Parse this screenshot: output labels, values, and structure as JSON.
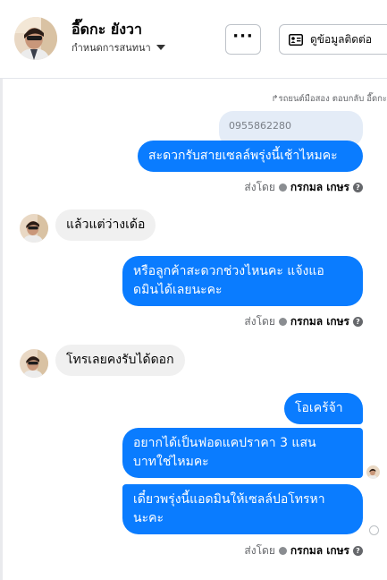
{
  "header": {
    "contact_name": "อี๊ดกะ ยังวา",
    "subtitle": "กำหนดการสนทนา",
    "more_label": "···",
    "contact_button_label": "ดูข้อมูลติดต่อ"
  },
  "thread": {
    "reply_note": "↱รถยนต์มือสอง ตอบกลับ อี๊ดกะ",
    "quoted_text": "0955862280",
    "messages": [
      {
        "direction": "out",
        "text": "สะดวกรับสายเซลล์พรุ่งนี้เช้าไหมคะ"
      },
      {
        "direction": "in",
        "text": "แล้วแต่ว่างเด้อ"
      },
      {
        "direction": "out",
        "line1": "หรือลูกค้าสะดวกช่วงไหนคะ แจ้งแอ",
        "line2": "ดมินได้เลยนะคะ"
      },
      {
        "direction": "in",
        "text": "โทรเลยคงรับได้ดอก"
      },
      {
        "direction": "out",
        "text": "โอเคร้จ้า"
      },
      {
        "direction": "out",
        "line1": "อยากได้เป็นฟอดแคปราคา 3 แสน",
        "line2": "บาทใช่ไหมคะ"
      },
      {
        "direction": "out",
        "line1": "เดี๋ยวพรุ่งนี้แอดมินให้เซลล์ปอโทรหา",
        "line2": "นะคะ"
      }
    ],
    "sent_by": {
      "prefix": "ส่งโดย",
      "name": "กรกมล เกษร",
      "help": "?"
    }
  },
  "colors": {
    "outgoing_bubble": "#0a7cff",
    "incoming_bubble": "#f0f0f0",
    "quoted_bubble": "#e4ecf7"
  }
}
